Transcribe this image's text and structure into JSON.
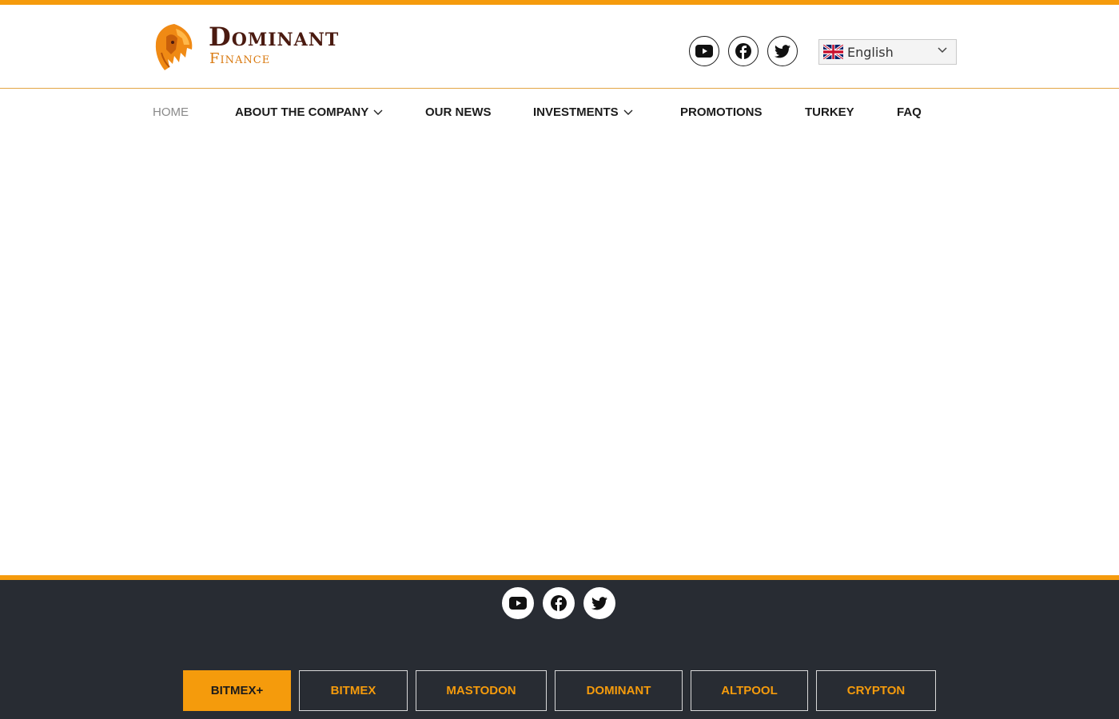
{
  "brand": {
    "name": "Dominant",
    "sub": "Finance"
  },
  "header_social": [
    {
      "icon": "youtube-icon"
    },
    {
      "icon": "facebook-icon"
    },
    {
      "icon": "twitter-icon"
    }
  ],
  "language": {
    "selected": "English",
    "flag": "uk-flag-icon"
  },
  "nav": {
    "items": [
      {
        "label": "HOME",
        "active": true
      },
      {
        "label": "ABOUT THE COMPANY",
        "dropdown": true
      },
      {
        "label": "OUR NEWS"
      },
      {
        "label": "INVESTMENTS",
        "dropdown": true
      },
      {
        "label": "PROMOTIONS"
      },
      {
        "label": "TURKEY"
      },
      {
        "label": "FAQ"
      }
    ]
  },
  "footer": {
    "tabs": [
      {
        "label": "BITMEX+",
        "active": true
      },
      {
        "label": "BITMEX"
      },
      {
        "label": "MASTODON"
      },
      {
        "label": "DOMINANT"
      },
      {
        "label": "ALTPOOL"
      },
      {
        "label": "CRYPTON"
      }
    ]
  },
  "colors": {
    "accent": "#f59b0c",
    "footer_bg": "#282c33",
    "brand_dark": "#4a1a10",
    "brand_orange": "#d9790f"
  }
}
